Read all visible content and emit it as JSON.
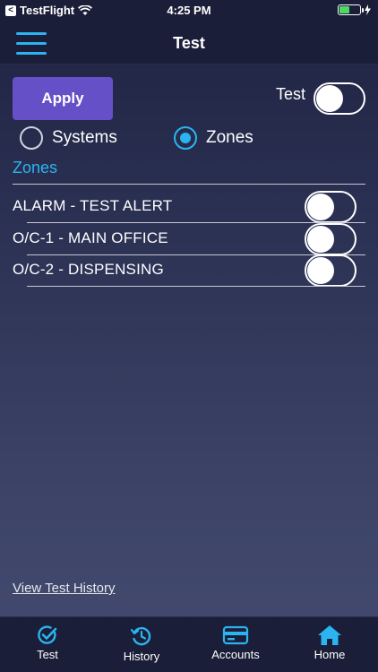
{
  "status_bar": {
    "carrier": "TestFlight",
    "time": "4:25 PM",
    "back_glyph": "<",
    "wifi_icon": "wifi-icon",
    "battery_level": 0.5
  },
  "nav": {
    "title": "Test",
    "menu_icon": "hamburger-menu-icon"
  },
  "controls": {
    "apply_label": "Apply",
    "test_label": "Test",
    "test_toggle_on": false
  },
  "mode": {
    "options": [
      {
        "label": "Systems",
        "selected": false
      },
      {
        "label": "Zones",
        "selected": true
      }
    ]
  },
  "zones": {
    "section_title": "Zones",
    "items": [
      {
        "label": "ALARM - TEST ALERT",
        "enabled": false
      },
      {
        "label": "O/C-1 - MAIN OFFICE",
        "enabled": false
      },
      {
        "label": "O/C-2 - DISPENSING",
        "enabled": false
      }
    ]
  },
  "footer": {
    "history_link": "View Test History"
  },
  "tabs": [
    {
      "label": "Test",
      "icon": "check-circle-icon",
      "active": true
    },
    {
      "label": "History",
      "icon": "history-icon",
      "active": false
    },
    {
      "label": "Accounts",
      "icon": "credit-card-icon",
      "active": false
    },
    {
      "label": "Home",
      "icon": "home-icon",
      "active": false
    }
  ],
  "colors": {
    "accent": "#2bb4f0",
    "apply_button": "#6650c8",
    "bar_background": "#1b1e38"
  }
}
